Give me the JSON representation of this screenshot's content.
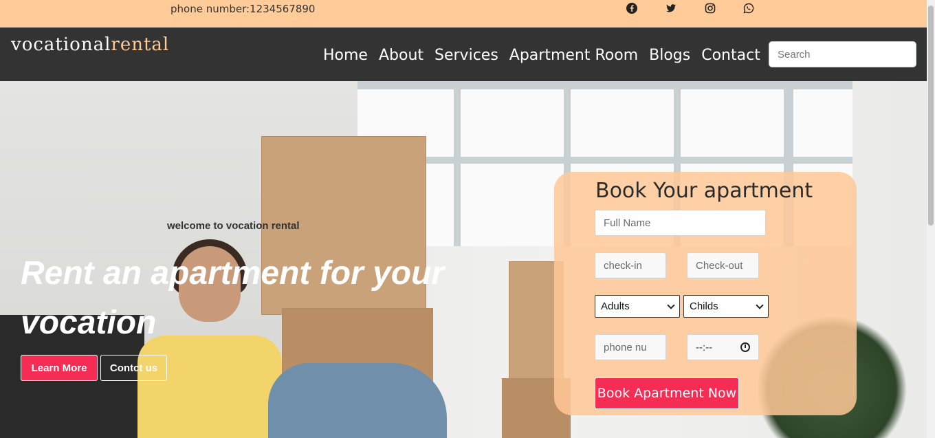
{
  "topbar": {
    "phone": "phone number:1234567890",
    "social": [
      "facebook-icon",
      "twitter-icon",
      "instagram-icon",
      "whatsapp-icon"
    ]
  },
  "navbar": {
    "logo_main": "vocational",
    "logo_accent": "rental",
    "links": [
      "Home",
      "About",
      "Services",
      "Apartment Room",
      "Blogs",
      "Contact"
    ],
    "search_placeholder": "Search"
  },
  "hero": {
    "welcome": "welcome to vocation rental",
    "title": "Rent an apartment for your vocation",
    "learn_more": "Learn More",
    "contact": "Contct us"
  },
  "booking": {
    "heading": "Book Your apartment",
    "fullname_placeholder": "Full Name",
    "checkin_placeholder": "check-in",
    "checkout_placeholder": "Check-out",
    "adults_selected": "Adults",
    "childs_selected": "Childs",
    "phone_placeholder": "phone nu",
    "time_value": "--:--",
    "submit": "Book Apartment Now"
  },
  "colors": {
    "topbar_bg": "#ffcc99",
    "navbar_bg": "#333333",
    "accent": "#f52d55",
    "logo_accent": "#ffcc99"
  }
}
